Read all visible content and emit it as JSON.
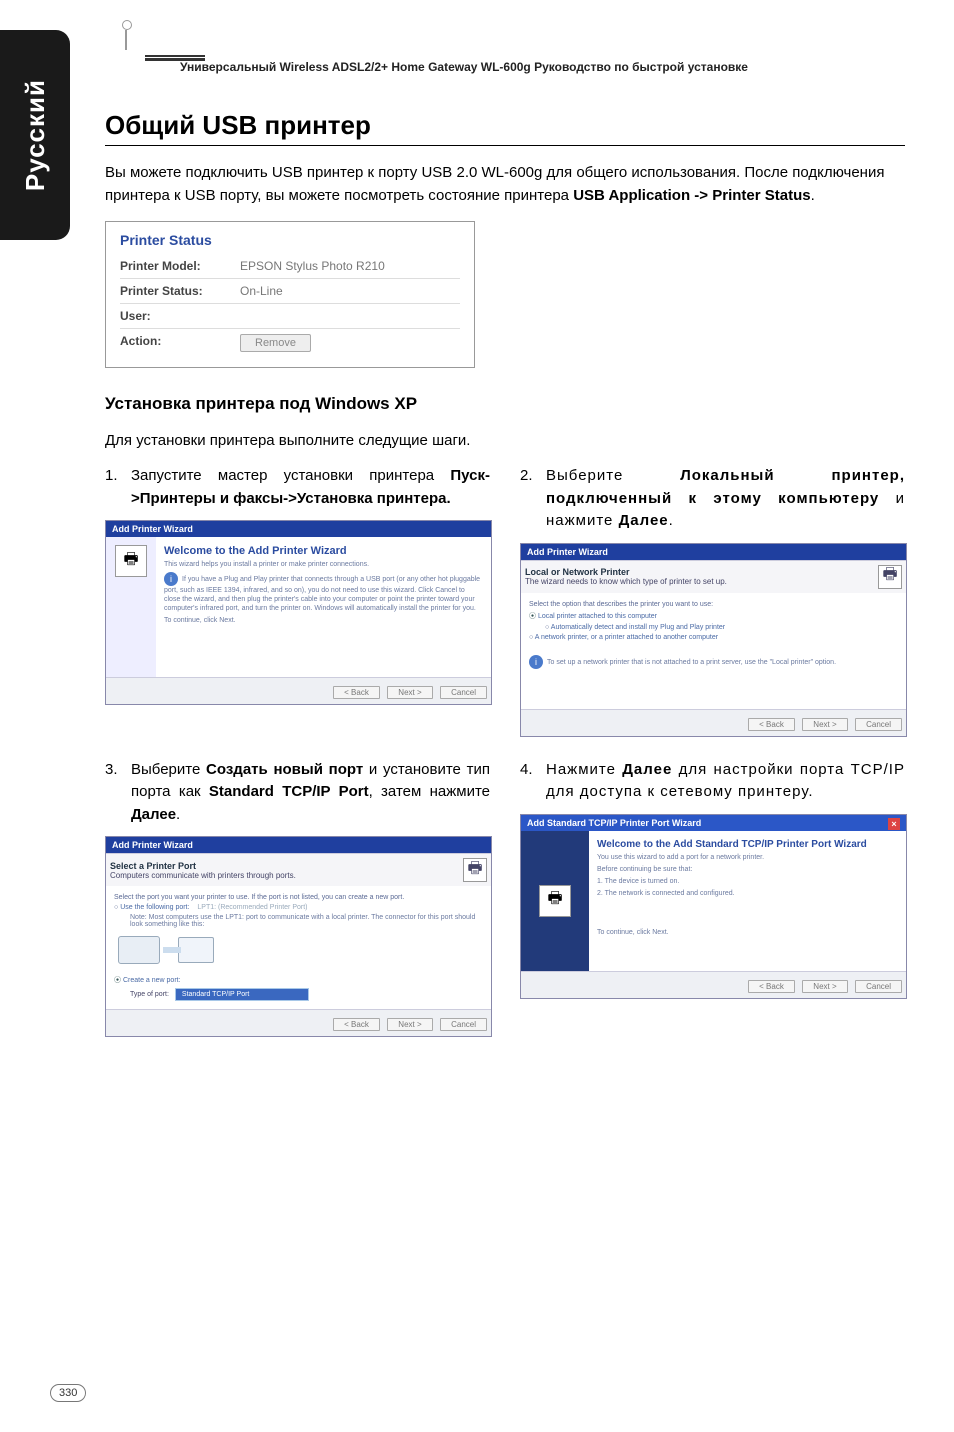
{
  "sidebar": {
    "lang_label": "Русский"
  },
  "header": {
    "text": "Универсальный Wireless ADSL2/2+ Home Gateway  WL-600g Руководство по быстрой установке"
  },
  "section": {
    "title": "Общий USB принтер",
    "intro_1": "Вы можете подключить USB принтер к порту USB 2.0 WL-600g для общего использования. После подключения принтера к USB порту, вы можете посмотреть состояние принтера ",
    "intro_bold": "USB Application ->  Printer Status",
    "intro_end": "."
  },
  "printer_status": {
    "panel_title": "Printer Status",
    "model_k": "Printer Model:",
    "model_v": "EPSON Stylus Photo R210",
    "status_k": "Printer Status:",
    "status_v": "On-Line",
    "user_k": "User:",
    "user_v": "",
    "action_k": "Action:",
    "remove_btn": "Remove"
  },
  "install": {
    "h2": "Установка принтера под Windows XP",
    "lead": "Для установки принтера выполните следущие шаги."
  },
  "steps": {
    "s1_n": "1.",
    "s1_t_a": "Запустите мастер установки принтера ",
    "s1_t_b": "Пуск->Принтеры и факсы->Установка принтера.",
    "s2_n": "2.",
    "s2_t_a": "Выберите ",
    "s2_t_b": "Локальный принтер, подключенный к этому компьютеру",
    "s2_t_c": " и нажмите ",
    "s2_t_d": "Далее",
    "s2_t_e": ".",
    "s3_n": "3.",
    "s3_t_a": "Выберите ",
    "s3_t_b": "Создать новый порт",
    "s3_t_c": " и установите тип порта как ",
    "s3_t_d": "Standard TCP/IP Port",
    "s3_t_e": ", затем нажмите ",
    "s3_t_f": "Далее",
    "s3_t_g": ".",
    "s4_n": "4.",
    "s4_t_a": "Нажмите ",
    "s4_t_b": "Далее",
    "s4_t_c": " для настройки порта TCP/IP для доступа к сетевому принтеру."
  },
  "wiz1": {
    "bar": "Add Printer Wizard",
    "title": "Welcome to the Add Printer Wizard",
    "sub": "This wizard helps you install a printer or make printer connections.",
    "info": "If you have a Plug and Play printer that connects through a USB port (or any other hot pluggable port, such as IEEE 1394, infrared, and so on), you do not need to use this wizard. Click Cancel to close the wizard, and then plug the printer's cable into your computer or point the printer toward your computer's infrared port, and turn the printer on. Windows will automatically install the printer for you.",
    "cont": "To continue, click Next.",
    "back": "< Back",
    "next": "Next >",
    "cancel": "Cancel"
  },
  "wiz2": {
    "bar": "Add Printer Wizard",
    "title": "Local or Network Printer",
    "sub": "The wizard needs to know which type of printer to set up.",
    "q": "Select the option that describes the printer you want to use:",
    "opt1": "Local printer attached to this computer",
    "opt1b": "Automatically detect and install my Plug and Play printer",
    "opt2": "A network printer, or a printer attached to another computer",
    "hint": "To set up a network printer that is not attached to a print server, use the \"Local printer\" option.",
    "back": "< Back",
    "next": "Next >",
    "cancel": "Cancel"
  },
  "wiz3": {
    "bar": "Add Printer Wizard",
    "title": "Select a Printer Port",
    "sub": "Computers communicate with printers through ports.",
    "q": "Select the port you want your printer to use. If the port is not listed, you can create a new port.",
    "opt1": "Use the following port:",
    "opt1v": "LPT1: (Recommended Printer Port)",
    "note1": "Note: Most computers use the LPT1: port to communicate with a local printer. The connector for this port should look something like this:",
    "opt2": "Create a new port:",
    "opt2l": "Type of port:",
    "opt2v": "Standard TCP/IP Port",
    "back": "< Back",
    "next": "Next >",
    "cancel": "Cancel"
  },
  "wiz4": {
    "bar": "Add Standard TCP/IP Printer Port Wizard",
    "title": "Welcome to the Add Standard TCP/IP Printer Port Wizard",
    "sub": "You use this wizard to add a port for a network printer.",
    "pre": "Before continuing be sure that:",
    "l1": "1.  The device is turned on.",
    "l2": "2.  The network is connected and configured.",
    "cont": "To continue, click Next.",
    "back": "< Back",
    "next": "Next >",
    "cancel": "Cancel"
  },
  "page_number": "330"
}
